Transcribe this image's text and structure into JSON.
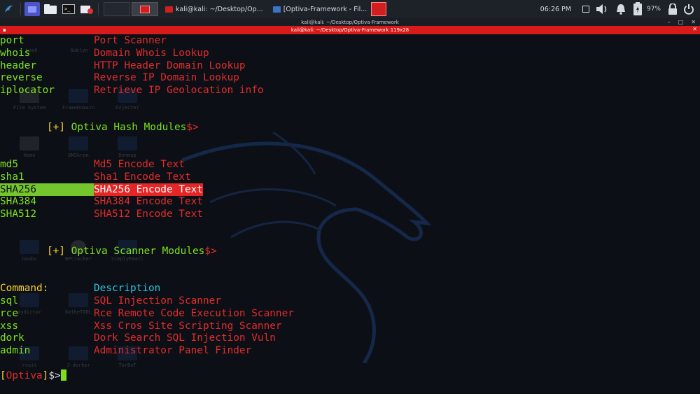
{
  "taskbar": {
    "tasks": [
      {
        "label": "kali@kali: ~/Desktop/Op..."
      },
      {
        "label": "[Optiva-Framework - Fil..."
      }
    ],
    "clock": "06:26 PM",
    "battery": "97%"
  },
  "window": {
    "title": "kali@kali: ~/Desktop/Optiva-Framework",
    "tab_title": "kali@kali: ~/Desktop/Optiva-Framework 119x28"
  },
  "desktop_icons": [
    "bash",
    "Goblyn",
    "File System",
    "FrameDomain",
    "Dzjecter",
    "Home",
    "DNSkron",
    "Dnnmap",
    "ols",
    "SubExtractor",
    "rack",
    "naabu",
    "WPCracker",
    "SimplyEmail",
    "pydictor",
    "GatheTOOL",
    "rsuit",
    "J-dorker",
    "TorBoT"
  ],
  "terminal": {
    "info_rows": [
      {
        "cmd": "port",
        "desc": "Port Scanner"
      },
      {
        "cmd": "whois",
        "desc": "Domain Whois Lookup"
      },
      {
        "cmd": "header",
        "desc": "HTTP Header Domain Lookup"
      },
      {
        "cmd": "reverse",
        "desc": "Reverse IP Domain Lookup"
      },
      {
        "cmd": "iplocator",
        "desc": "Retrieve IP Geolocation info"
      }
    ],
    "hash_header": {
      "prefix": "[+]",
      "title": "Optiva Hash Modules",
      "suffix": "$>"
    },
    "hash_rows": [
      {
        "cmd": "md5",
        "desc": "Md5 Encode Text"
      },
      {
        "cmd": "sha1",
        "desc": "Sha1 Encode Text"
      },
      {
        "cmd": "SHA256",
        "desc": "SHA256 Encode Text"
      },
      {
        "cmd": "SHA384",
        "desc": "SHA384 Encode Text"
      },
      {
        "cmd": "SHA512",
        "desc": "SHA512 Encode Text"
      }
    ],
    "scanner_header": {
      "prefix": "[+]",
      "title": "Optiva Scanner Modules",
      "suffix": "$>"
    },
    "columns": {
      "command": "Command:",
      "description": "Description"
    },
    "scanner_rows": [
      {
        "cmd": "sql",
        "desc": "SQL Injection Scanner"
      },
      {
        "cmd": "rce",
        "desc": "Rce Remote Code Execution Scanner"
      },
      {
        "cmd": "xss",
        "desc": "Xss Cros Site Scripting Scanner"
      },
      {
        "cmd": "dork",
        "desc": "Dork Search SQL Injection Vuln"
      },
      {
        "cmd": "admin",
        "desc": "Administrator Panel Finder"
      }
    ],
    "prompt": {
      "open": "[",
      "name": "Optiva",
      "close": "]",
      "sign": "$>"
    }
  },
  "colors": {
    "accent_red": "#e22b2b",
    "accent_green": "#7ee01d",
    "yellow": "#f7d02d",
    "cyan": "#2ec1dc"
  },
  "icons": [
    "kali-menu-icon",
    "terminal-icon",
    "folder-icon",
    "window-icon",
    "volume-icon",
    "bell-icon",
    "battery-icon",
    "lock-icon",
    "power-icon"
  ]
}
